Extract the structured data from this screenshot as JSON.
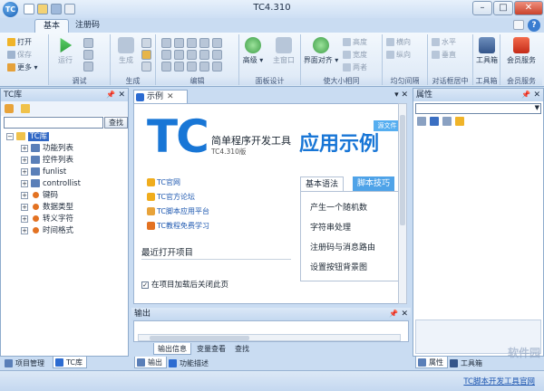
{
  "window": {
    "title": "TC4.310"
  },
  "ribbon_tabs": [
    "基本",
    "注册码"
  ],
  "ribbon": {
    "file": {
      "open": "打开",
      "save": "保存",
      "more": "更多"
    },
    "groups": {
      "debug": {
        "label": "调试",
        "run": "运行"
      },
      "generate": {
        "label": "生成",
        "build": "生成"
      },
      "edit": {
        "label": "编辑"
      },
      "panel_design": {
        "label": "面板设计",
        "advanced": "高级",
        "main_window": "主窗口"
      },
      "size_layout": {
        "label": "使大小相同",
        "interface_align": "界面对齐",
        "height": "高度",
        "width": "宽度",
        "both": "两者"
      },
      "even_space": {
        "label": "均匀间隔",
        "horizontal": "横向",
        "vertical": "纵向"
      },
      "dialog_center": {
        "label": "对话框居中",
        "horizontal": "水平",
        "vertical": "垂直"
      },
      "toolbox": {
        "label": "工具箱",
        "item": "工具箱"
      },
      "vip": {
        "label": "会员服务",
        "item": "会员服务"
      }
    }
  },
  "left_panel": {
    "title": "TC库",
    "search_button": "查找",
    "search_value": "",
    "tree": {
      "root": "TC库",
      "items": [
        "功能列表",
        "控件列表",
        "funlist",
        "controllist",
        "键码",
        "数据类型",
        "转义字符",
        "时间格式"
      ]
    },
    "bottom_tabs": [
      "项目管理",
      "TC库"
    ]
  },
  "doc": {
    "tab": "示例",
    "logo": "TC",
    "subtitle": "简单程序开发工具",
    "version": "TC4.310版",
    "demo_title": "应用示例",
    "badge": "源文件",
    "links": [
      "TC官网",
      "TC官方论坛",
      "TC脚本应用平台",
      "TC教程免费学习"
    ],
    "recent_title": "最近打开项目",
    "close_checkbox": "在项目加载后关闭此页",
    "tips_tabs": [
      "基本语法",
      "脚本技巧"
    ],
    "tips": [
      "产生一个随机数",
      "字符串处理",
      "注册码与消息路由",
      "设置按钮背景图"
    ]
  },
  "output_panel": {
    "title": "输出",
    "tabs": [
      "输出信息",
      "变量查看",
      "查找"
    ],
    "bottom_tabs": [
      "输出",
      "功能描述"
    ]
  },
  "right_panel": {
    "title": "属性",
    "bottom_tabs": [
      "属性",
      "工具箱"
    ]
  },
  "status": {
    "link": "TC脚本开发工具官网"
  },
  "watermark": "软件园"
}
